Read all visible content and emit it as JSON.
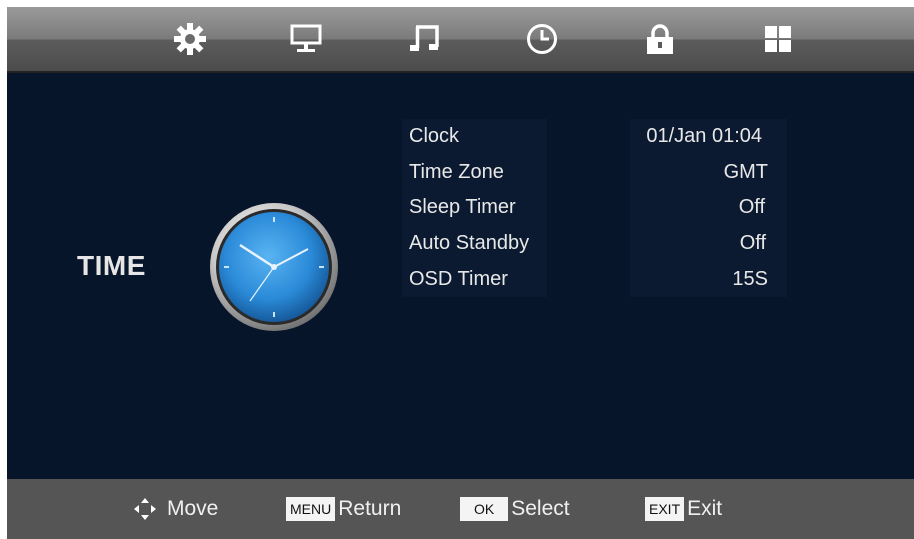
{
  "tabs": [
    {
      "name": "picture",
      "icon": "sun-gear-icon"
    },
    {
      "name": "screen",
      "icon": "monitor-icon"
    },
    {
      "name": "sound",
      "icon": "music-note-icon"
    },
    {
      "name": "time",
      "icon": "clock-icon"
    },
    {
      "name": "lock",
      "icon": "padlock-icon"
    },
    {
      "name": "setup",
      "icon": "grid-icon"
    }
  ],
  "section": {
    "title": "TIME"
  },
  "menu": {
    "items": [
      {
        "label": "Clock",
        "value": "01/Jan 01:04"
      },
      {
        "label": "Time Zone",
        "value": "GMT"
      },
      {
        "label": "Sleep Timer",
        "value": "Off"
      },
      {
        "label": "Auto Standby",
        "value": "Off"
      },
      {
        "label": "OSD Timer",
        "value": "15S"
      }
    ]
  },
  "footer": {
    "move": {
      "label": "Move"
    },
    "return": {
      "key": "MENU",
      "label": "Return"
    },
    "select": {
      "key": "OK",
      "label": "Select"
    },
    "exit": {
      "key": "EXIT",
      "label": "Exit"
    }
  },
  "colors": {
    "background": "#07152a",
    "bar": "#555555",
    "text": "#e8e8e8",
    "clock_face": "#2a8ad8"
  }
}
